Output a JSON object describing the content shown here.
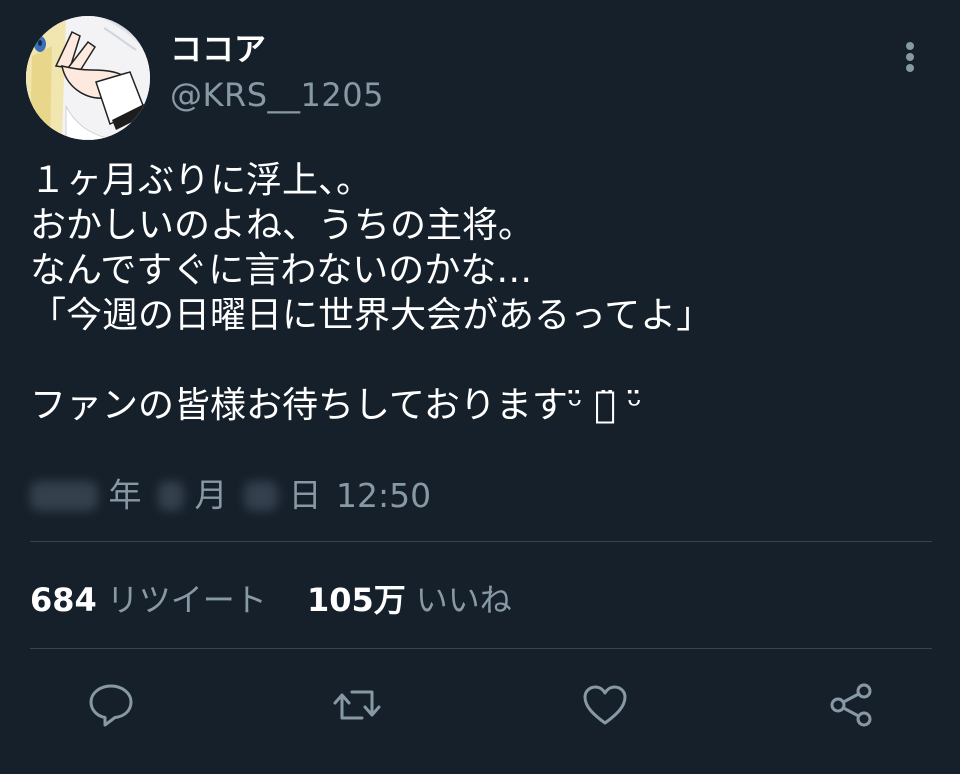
{
  "author": {
    "display_name": "ココア",
    "handle": "@KRS__1205"
  },
  "tweet": {
    "lines": [
      "１ヶ月ぶりに浮上、。",
      "おかしいのよね、うちの主将。",
      "なんですぐに言わないのかな…",
      "「今週の日曜日に世界大会があるってよ」",
      "",
      "ファンの皆様お待ちしておりますᵕ̈ ꒡̈ ᵕ̈"
    ]
  },
  "timestamp": {
    "year_unit": "年",
    "month_unit": "月",
    "day_unit": "日",
    "time": "12:50"
  },
  "stats": {
    "retweets_count": "684",
    "retweets_label": "リツイート",
    "likes_count": "105万",
    "likes_label": "いいね"
  },
  "icons": {
    "more": "more-vertical-icon",
    "reply": "reply-icon",
    "retweet": "retweet-icon",
    "like": "heart-icon",
    "share": "share-icon"
  },
  "colors": {
    "background": "#15202b",
    "text_primary": "#ffffff",
    "text_secondary": "#8899a6",
    "divider": "#38444d"
  }
}
